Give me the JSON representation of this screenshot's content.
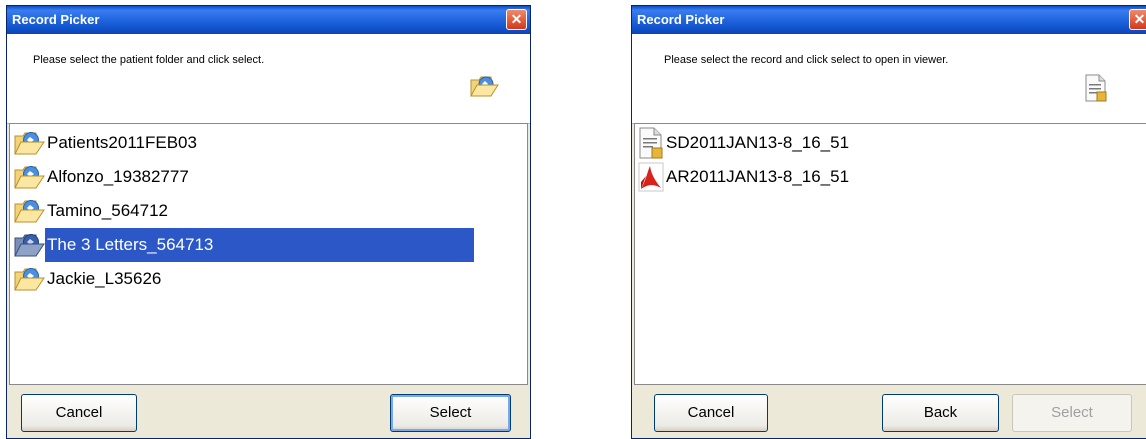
{
  "folder_dialog": {
    "title": "Record Picker",
    "close_glyph": "✕",
    "instruction": "Please select the patient folder and click select.",
    "header_icon": "open-folder-icon",
    "items": [
      {
        "label": "Patients2011FEB03",
        "icon": "folder-icon",
        "selected": false
      },
      {
        "label": "Alfonzo_19382777",
        "icon": "folder-icon",
        "selected": false
      },
      {
        "label": "Tamino_564712",
        "icon": "folder-icon",
        "selected": false
      },
      {
        "label": "The 3 Letters_564713",
        "icon": "folder-icon",
        "selected": true
      },
      {
        "label": "Jackie_L35626",
        "icon": "folder-icon",
        "selected": false
      }
    ],
    "buttons": {
      "cancel": "Cancel",
      "select": "Select"
    }
  },
  "record_dialog": {
    "title": "Record Picker",
    "close_glyph": "✕",
    "instruction": "Please select the record and click select to open in viewer.",
    "header_icon": "document-icon",
    "items": [
      {
        "label": "SD2011JAN13-8_16_51",
        "icon": "document-icon"
      },
      {
        "label": "AR2011JAN13-8_16_51",
        "icon": "pdf-icon"
      }
    ],
    "buttons": {
      "cancel": "Cancel",
      "back": "Back",
      "select": "Select",
      "select_enabled": false
    }
  },
  "colors": {
    "titlebar": "#0a4fc7",
    "selection": "#2b57c7",
    "dialog_bg": "#ece9d8"
  }
}
